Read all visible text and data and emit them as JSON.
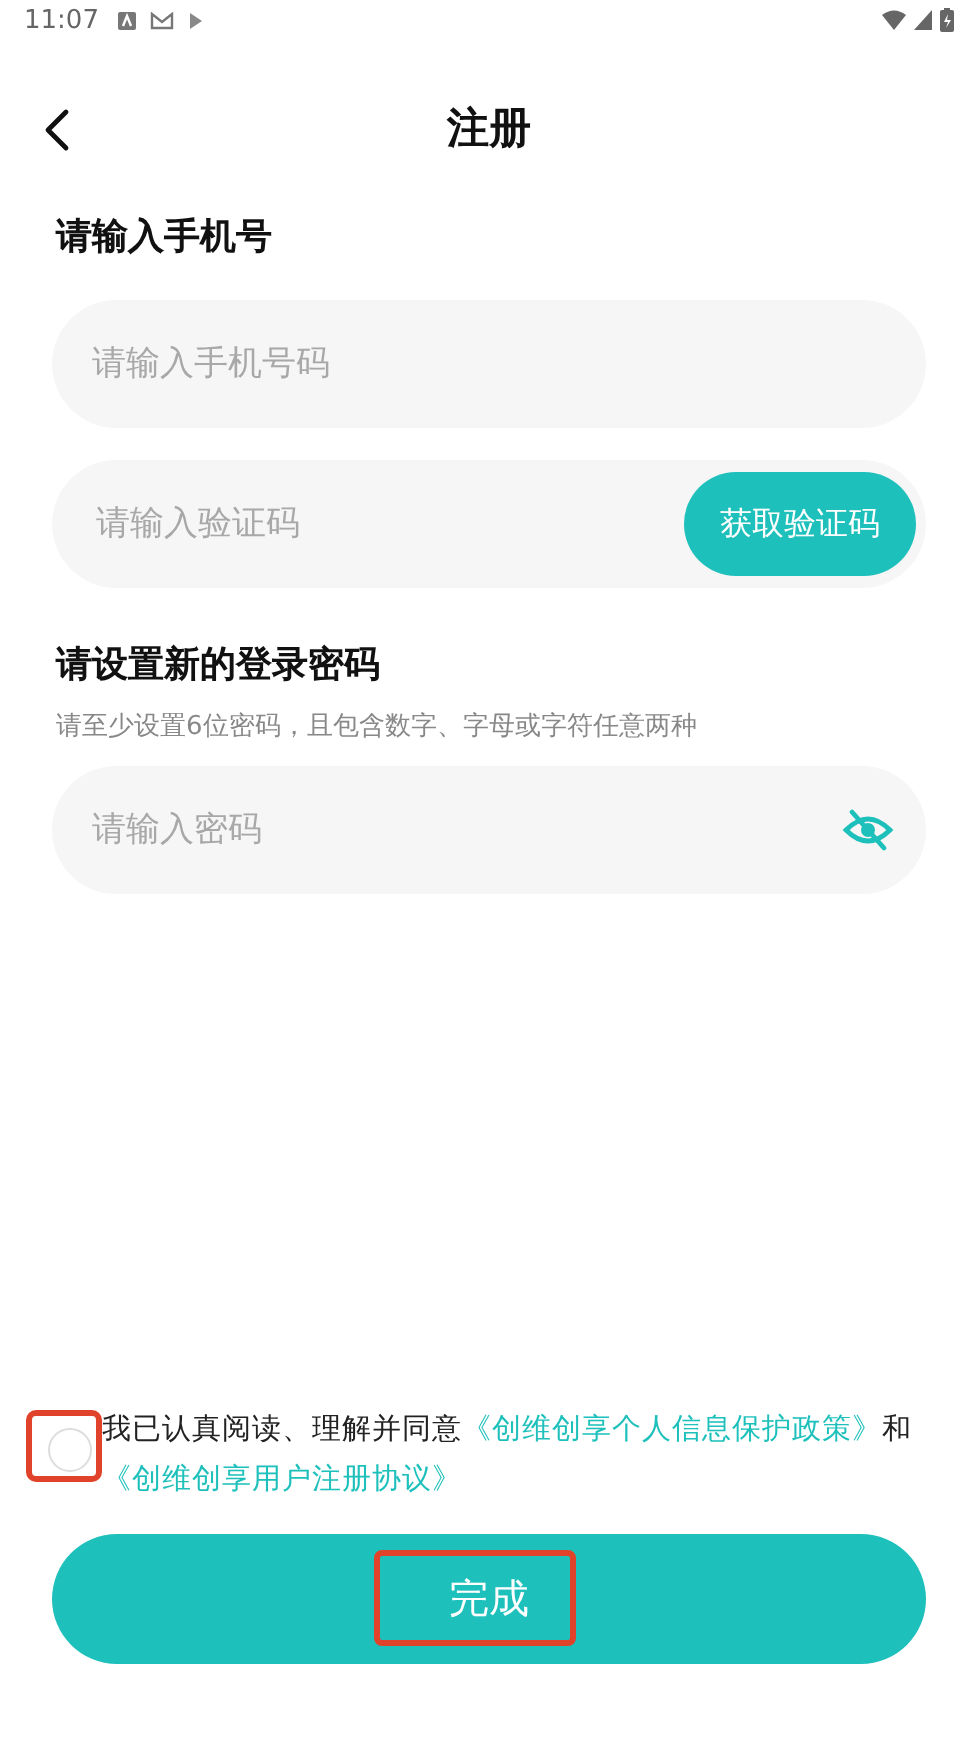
{
  "status_bar": {
    "time": "11:07"
  },
  "header": {
    "title": "注册"
  },
  "phone_section": {
    "title": "请输入手机号",
    "phone_field": {
      "placeholder": "请输入手机号码"
    },
    "code_field": {
      "placeholder": "请输入验证码"
    },
    "code_button": "获取验证码"
  },
  "password_section": {
    "title": "请设置新的登录密码",
    "hint": "请至少设置6位密码，且包含数字、字母或字符任意两种",
    "password_field": {
      "placeholder": "请输入密码",
      "visible": false
    }
  },
  "agreement": {
    "checked": false,
    "highlighted": true,
    "text": "我已认真阅读、理解并同意",
    "links": [
      "《创维创享个人信息保护政策》",
      "《创维创享用户注册协议》"
    ],
    "joiner": "和"
  },
  "done_button": {
    "label": "完成",
    "highlighted": true
  }
}
